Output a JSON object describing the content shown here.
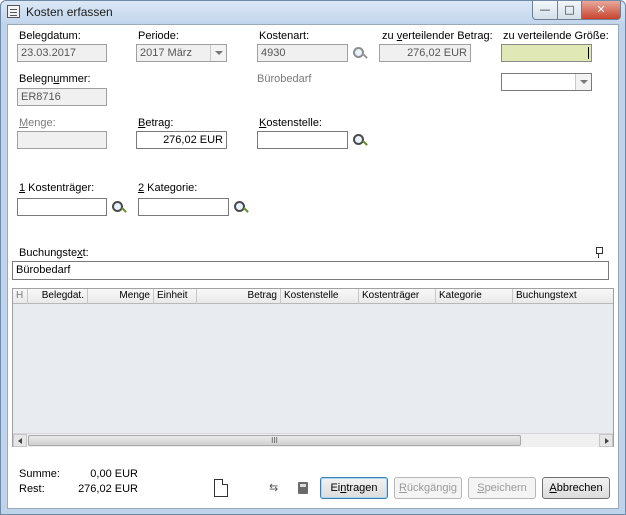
{
  "window": {
    "title": "Kosten erfassen",
    "min_glyph": "—",
    "max_glyph": "□",
    "close_glyph": "✕"
  },
  "form": {
    "belegdatum": {
      "label_pre": "Belegdatum",
      "label_u": "",
      "label_post": ":",
      "value": "23.03.2017"
    },
    "periode": {
      "label": "Periode:",
      "value": "2017  März"
    },
    "kostenart": {
      "label": "Kostenart:",
      "value": "4930",
      "description": "Bürobedarf"
    },
    "zu_verteilender_betrag": {
      "label_pre": "zu ",
      "label_u": "v",
      "label_post": "erteilender Betrag:",
      "value": "276,02 EUR"
    },
    "zu_verteilende_groesse": {
      "label": "zu verteilende Größe:",
      "value": "",
      "select_value": ""
    },
    "belegnummer": {
      "label_pre": "Belegn",
      "label_u": "u",
      "label_post": "mmer:",
      "value": "ER8716"
    },
    "menge": {
      "label_pre": "",
      "label_u": "M",
      "label_post": "enge:",
      "value": ""
    },
    "betrag": {
      "label_pre": "",
      "label_u": "B",
      "label_post": "etrag:",
      "value": "276,02 EUR"
    },
    "kostenstelle": {
      "label_pre": "",
      "label_u": "K",
      "label_post": "ostenstelle:",
      "value": ""
    },
    "kostentraeger": {
      "label_pre": "",
      "label_u": "1",
      "label_post": " Kostenträger:",
      "value": ""
    },
    "kategorie": {
      "label_pre": "",
      "label_u": "2",
      "label_post": " Kategorie:",
      "value": ""
    },
    "buchungstext": {
      "label_pre": "Buchungste",
      "label_u": "x",
      "label_post": "t:",
      "value": "Bürobedarf"
    }
  },
  "grid": {
    "columns": [
      "H",
      "Belegdat.",
      "Menge",
      "Einheit",
      "Betrag",
      "Kostenstelle",
      "Kostenträger",
      "Kategorie",
      "Buchungstext"
    ],
    "rows": [],
    "scroll_grip": "III"
  },
  "summary": {
    "summe_label": "Summe:",
    "summe_value": "0,00 EUR",
    "rest_label": "Rest:",
    "rest_value": "276,02 EUR"
  },
  "buttons": {
    "eintragen": {
      "pre": "Ei",
      "u": "n",
      "post": "tragen"
    },
    "rueckgaengig": {
      "pre": "",
      "u": "R",
      "post": "ückgängig"
    },
    "speichern": {
      "pre": "",
      "u": "S",
      "post": "peichern"
    },
    "abbrechen": {
      "pre": "",
      "u": "A",
      "post": "bbrechen"
    }
  },
  "icons": [
    "app-icon",
    "search-icon",
    "pin-icon",
    "new-document-icon",
    "swap-icon",
    "book-icon"
  ]
}
